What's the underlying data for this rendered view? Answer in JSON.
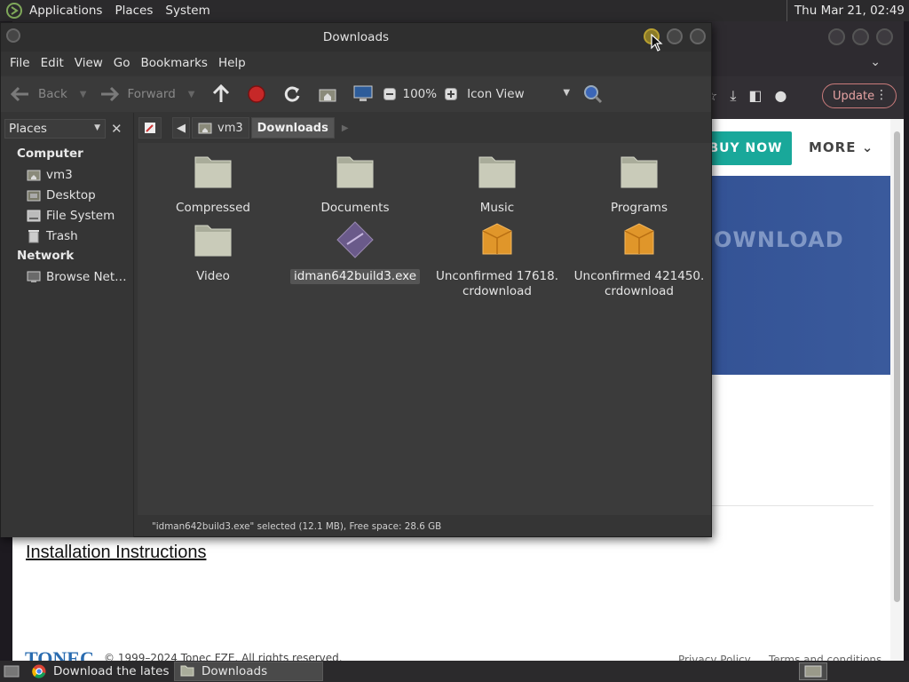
{
  "top_panel": {
    "menus": [
      "Applications",
      "Places",
      "System"
    ],
    "clock": "Thu Mar 21, 02:49"
  },
  "browser": {
    "update_label": "Update",
    "buy_now": "BUY NOW",
    "more": "MORE",
    "banner_text": "OWNLOAD",
    "install_link": "Installation Instructions",
    "footer_logo": "TONEC",
    "copyright": "© 1999–2024 Tonec FZE. All rights reserved.",
    "privacy": "Privacy Policy",
    "terms": "Terms and conditions"
  },
  "file_manager": {
    "title": "Downloads",
    "menu": [
      "File",
      "Edit",
      "View",
      "Go",
      "Bookmarks",
      "Help"
    ],
    "toolbar": {
      "back": "Back",
      "forward": "Forward",
      "zoom": "100%",
      "view_mode": "Icon View"
    },
    "sidebar": {
      "selector": "Places",
      "computer_heading": "Computer",
      "items": [
        "vm3",
        "Desktop",
        "File System",
        "Trash"
      ],
      "network_heading": "Network",
      "network_items": [
        "Browse Net…"
      ]
    },
    "pathbar": [
      "vm3",
      "Downloads"
    ],
    "files": [
      {
        "name": "Compressed",
        "type": "folder"
      },
      {
        "name": "Documents",
        "type": "folder"
      },
      {
        "name": "Music",
        "type": "folder"
      },
      {
        "name": "Programs",
        "type": "folder"
      },
      {
        "name": "Video",
        "type": "folder"
      },
      {
        "name": "idman642build3.exe",
        "type": "exe",
        "selected": true
      },
      {
        "name": "Unconfirmed 17618.\ncrdownload",
        "type": "package"
      },
      {
        "name": "Unconfirmed 421450.\ncrdownload",
        "type": "package"
      }
    ],
    "status": "\"idman642build3.exe\" selected (12.1 MB), Free space: 28.6 GB"
  },
  "taskbar": {
    "tasks": [
      "Download the lates…",
      "Downloads"
    ]
  }
}
